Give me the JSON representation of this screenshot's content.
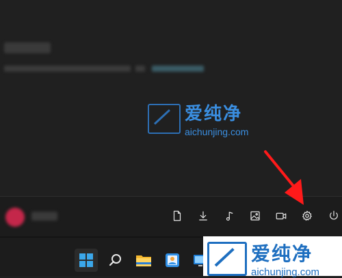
{
  "watermark": {
    "brand_cn": "爱纯净",
    "brand_url": "aichunjing.com",
    "color": "#3a8ee0"
  },
  "start_footer": {
    "quick_icons": [
      "document-icon",
      "download-icon",
      "music-icon",
      "pictures-icon",
      "video-icon",
      "settings-icon",
      "power-icon"
    ]
  },
  "annotation": {
    "arrow_color": "#ff1a1a"
  },
  "taskbar": {
    "items": [
      "start-button",
      "search-button",
      "file-explorer",
      "photos-app",
      "remote-desktop-app"
    ]
  }
}
